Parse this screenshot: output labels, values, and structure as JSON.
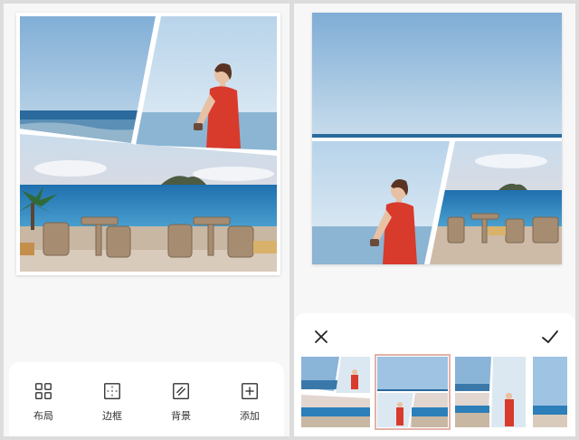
{
  "left_panel": {
    "toolbar": [
      {
        "key": "layout",
        "label": "布局",
        "icon": "layout-grid-icon"
      },
      {
        "key": "border",
        "label": "边框",
        "icon": "border-icon"
      },
      {
        "key": "background",
        "label": "背景",
        "icon": "background-icon"
      },
      {
        "key": "add",
        "label": "添加",
        "icon": "add-icon"
      }
    ]
  },
  "right_panel": {
    "close_icon": "close-icon",
    "confirm_icon": "checkmark-icon",
    "layout_options": [
      {
        "name": "layout-diagonal-top",
        "selected": false
      },
      {
        "name": "layout-wide-top-two-bottom",
        "selected": true
      },
      {
        "name": "layout-three-diagonal",
        "selected": false
      },
      {
        "name": "layout-single-column",
        "selected": false
      }
    ]
  },
  "colors": {
    "sky": "#9fc3e2",
    "sea": "#1e7ab8",
    "dress": "#d83a2c",
    "selected_outline": "#e2b2a8"
  }
}
